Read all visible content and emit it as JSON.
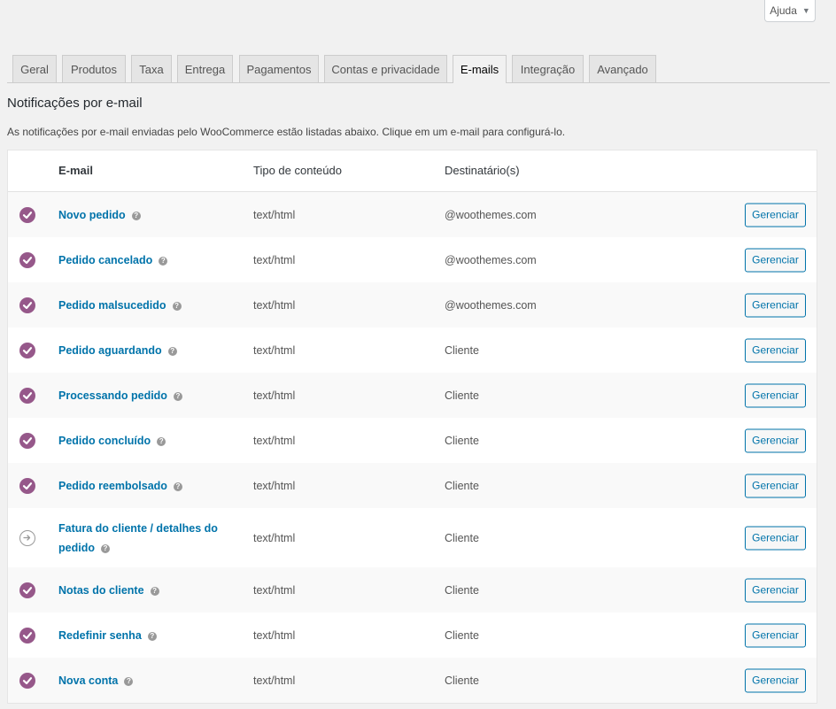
{
  "help": {
    "label": "Ajuda"
  },
  "tabs": [
    {
      "label": "Geral"
    },
    {
      "label": "Produtos"
    },
    {
      "label": "Taxa"
    },
    {
      "label": "Entrega"
    },
    {
      "label": "Pagamentos"
    },
    {
      "label": "Contas e privacidade"
    },
    {
      "label": "E-mails"
    },
    {
      "label": "Integração"
    },
    {
      "label": "Avançado"
    }
  ],
  "active_tab": "E-mails",
  "section": {
    "title": "Notificações por e-mail",
    "description": "As notificações por e-mail enviadas pelo WooCommerce estão listadas abaixo. Clique em um e-mail para configurá-lo."
  },
  "table": {
    "headers": {
      "email": "E-mail",
      "content_type": "Tipo de conteúdo",
      "recipients": "Destinatário(s)"
    },
    "rows": [
      {
        "name": "Novo pedido",
        "content_type": "text/html",
        "recipient": "@woothemes.com",
        "enabled": true,
        "action": "Gerenciar"
      },
      {
        "name": "Pedido cancelado",
        "content_type": "text/html",
        "recipient": "@woothemes.com",
        "enabled": true,
        "action": "Gerenciar"
      },
      {
        "name": "Pedido malsucedido",
        "content_type": "text/html",
        "recipient": "@woothemes.com",
        "enabled": true,
        "action": "Gerenciar"
      },
      {
        "name": "Pedido aguardando",
        "content_type": "text/html",
        "recipient": "Cliente",
        "enabled": true,
        "action": "Gerenciar"
      },
      {
        "name": "Processando pedido",
        "content_type": "text/html",
        "recipient": "Cliente",
        "enabled": true,
        "action": "Gerenciar"
      },
      {
        "name": "Pedido concluído",
        "content_type": "text/html",
        "recipient": "Cliente",
        "enabled": true,
        "action": "Gerenciar"
      },
      {
        "name": "Pedido reembolsado",
        "content_type": "text/html",
        "recipient": "Cliente",
        "enabled": true,
        "action": "Gerenciar"
      },
      {
        "name": "Fatura do cliente / detalhes do pedido",
        "content_type": "text/html",
        "recipient": "Cliente",
        "enabled": false,
        "action": "Gerenciar"
      },
      {
        "name": "Notas do cliente",
        "content_type": "text/html",
        "recipient": "Cliente",
        "enabled": true,
        "action": "Gerenciar"
      },
      {
        "name": "Redefinir senha",
        "content_type": "text/html",
        "recipient": "Cliente",
        "enabled": true,
        "action": "Gerenciar"
      },
      {
        "name": "Nova conta",
        "content_type": "text/html",
        "recipient": "Cliente",
        "enabled": true,
        "action": "Gerenciar"
      }
    ]
  },
  "colors": {
    "accent": "#96588a",
    "link": "#0073aa"
  },
  "icons": {
    "enabled": "check-circle-icon",
    "manual": "arrow-circle-icon",
    "help": "question-icon"
  }
}
